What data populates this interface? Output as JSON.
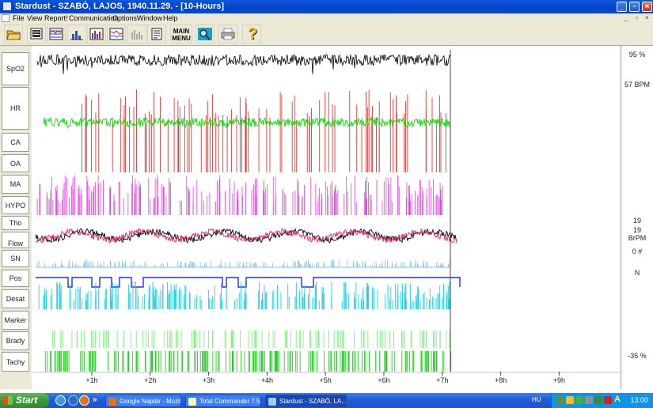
{
  "window": {
    "title": "Stardust - SZABÓ, LAJOS, 1940.11.29.  - [10-Hours]"
  },
  "menu": [
    "File",
    "View",
    "Report!",
    "Communication",
    "Options",
    "Window",
    "Help"
  ],
  "toolbar": {
    "main_menu_label_1": "MAIN",
    "main_menu_label_2": "MENU",
    "help_glyph": "?",
    "icons": [
      "open-folder-icon",
      "monitor-icon",
      "multi-chart-icon",
      "bar-chart-icon",
      "trend-chart-icon",
      "stats-chart-icon",
      "disabled-chart-icon",
      "report-icon",
      "main-menu",
      "search-icon",
      "print-icon",
      "help-icon"
    ]
  },
  "channels": [
    {
      "id": "spo2",
      "label": "SpO2",
      "value": "95 %"
    },
    {
      "id": "hr",
      "label": "HR",
      "value": "57 BPM"
    },
    {
      "id": "ca",
      "label": "CA",
      "value": ""
    },
    {
      "id": "oa",
      "label": "OA",
      "value": ""
    },
    {
      "id": "ma",
      "label": "MA",
      "value": ""
    },
    {
      "id": "hypo",
      "label": "HYPO",
      "value": ""
    },
    {
      "id": "tho",
      "label": "Tho",
      "value": "19"
    },
    {
      "id": "flow",
      "label": "Flow",
      "value": "19\nBrPM"
    },
    {
      "id": "sn",
      "label": "SN",
      "value": "0 #"
    },
    {
      "id": "pos",
      "label": "Pos",
      "value": "N"
    },
    {
      "id": "desat",
      "label": "Desat",
      "value": ""
    },
    {
      "id": "marker",
      "label": "Marker",
      "value": ""
    },
    {
      "id": "brady",
      "label": "Brady",
      "value": ""
    },
    {
      "id": "tachy",
      "label": "Tachy",
      "value": "-35 %"
    }
  ],
  "right_values": {
    "spo2": "95 %",
    "hr": "57 BPM",
    "tho": "19",
    "flow_1": "19",
    "flow_2": "BrPM",
    "sn": "0 #",
    "pos": "N",
    "tachy": "-35 %"
  },
  "time_axis": [
    "+1h",
    "+2h",
    "+3h",
    "+4h",
    "+5h",
    "+6h",
    "+7h",
    "+8h",
    "+9h"
  ],
  "colors": {
    "spo2": "#000000",
    "hr": "#00e000",
    "ca_oa": "#e02020",
    "ma_hypo": "#e040e0",
    "flow_a": "#000000",
    "flow_b": "#e0206a",
    "sn": "#80c0f0",
    "pos": "#2030e0",
    "desat": "#20d0e0",
    "brady": "#80f080",
    "tachy": "#20d020"
  },
  "taskbar": {
    "start_label": "Start",
    "tasks": [
      "Google Naptár - Mozill...",
      "Total Commander 7.5...",
      "Stardust - SZABÓ, LA..."
    ],
    "language": "HU",
    "clock": "13:00"
  }
}
